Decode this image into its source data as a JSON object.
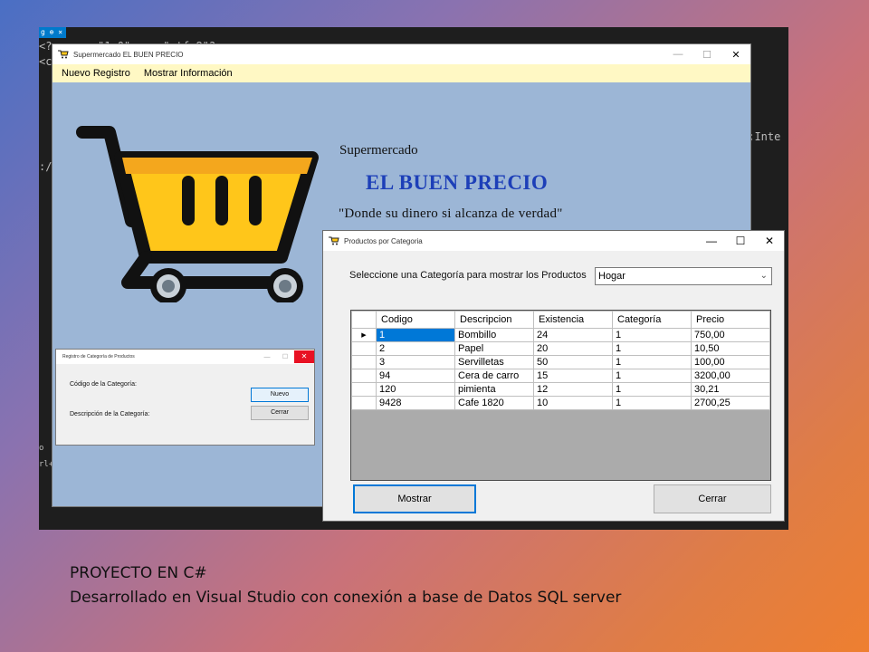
{
  "ide": {
    "tab_label": "g ⊕ ×",
    "code_lines": [
      "<?xm  ...  \"1.0\" ... \"utf-8\"?>",
      "<co",
      "o;Inte",
      ":/",
      "o",
      "rl+E"
    ]
  },
  "main_window": {
    "title": "Supermercado EL BUEN PRECIO",
    "menu": [
      "Nuevo Registro",
      "Mostrar Información"
    ],
    "brand_subtitle": "Supermercado",
    "brand_title": "EL BUEN PRECIO",
    "brand_slogan": "\"Donde su dinero si alcanza de verdad\"",
    "colors": {
      "background": "#9cb6d6",
      "menu_bg": "#fff8c4",
      "title_blue": "#1d3fb8",
      "cart_yellow": "#ffc61a"
    }
  },
  "category_window": {
    "title": "Registro de Categoría de Productos",
    "code_label": "Código de la Categoría:",
    "desc_label": "Descripción de la Categoría:",
    "new_button": "Nuevo",
    "close_button": "Cerrar"
  },
  "products_window": {
    "title": "Productos por Categoria",
    "prompt": "Seleccione una Categoría para mostrar los Productos",
    "selected_category": "Hogar",
    "columns": [
      "Codigo",
      "Descripcion",
      "Existencia",
      "Categoría",
      "Precio"
    ],
    "rows": [
      [
        "1",
        "Bombillo",
        "24",
        "1",
        "750,00"
      ],
      [
        "2",
        "Papel",
        "20",
        "1",
        "10,50"
      ],
      [
        "3",
        "Servilletas",
        "50",
        "1",
        "100,00"
      ],
      [
        "94",
        "Cera de carro",
        "15",
        "1",
        "3200,00"
      ],
      [
        "120",
        "pimienta",
        "12",
        "1",
        "30,21"
      ],
      [
        "9428",
        "Cafe 1820",
        "10",
        "1",
        "2700,25"
      ]
    ],
    "show_button": "Mostrar",
    "close_button": "Cerrar"
  },
  "caption": {
    "line1": "PROYECTO EN C#",
    "line2": "Desarrollado en Visual Studio con conexión a base de Datos SQL server"
  }
}
